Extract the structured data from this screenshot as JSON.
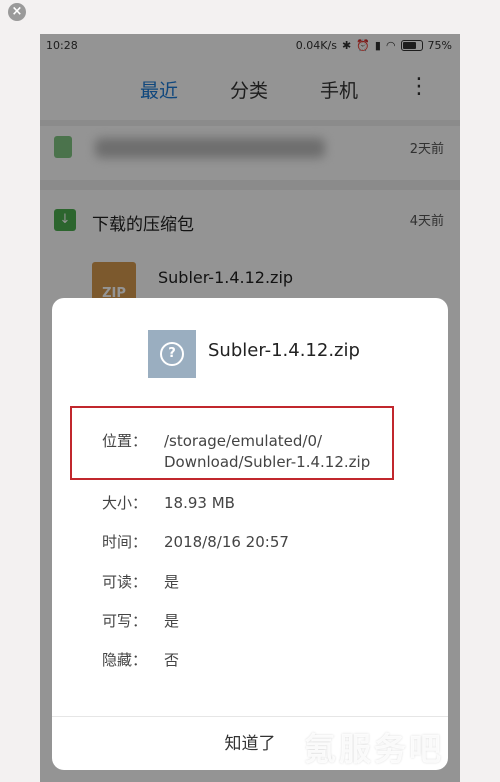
{
  "status_bar": {
    "time": "10:28",
    "network_speed": "0.04K/s",
    "battery": "75%"
  },
  "tabs": [
    {
      "label": "最近",
      "active": true
    },
    {
      "label": "分类",
      "active": false
    },
    {
      "label": "手机",
      "active": false
    }
  ],
  "list": {
    "blurred_item": {
      "date": "2天前"
    },
    "folder": {
      "label": "下载的压缩包",
      "date": "4天前"
    },
    "zip_item": {
      "icon_text": "ZIP",
      "name": "Subler-1.4.12.zip"
    }
  },
  "dialog": {
    "file_name": "Subler-1.4.12.zip",
    "location_key": "位置：",
    "location_value_line1": "/storage/emulated/0/",
    "location_value_line2": "Download/Subler-1.4.12.zip",
    "size_key": "大小：",
    "size_value": "18.93 MB",
    "time_key": "时间：",
    "time_value": "2018/8/16 20:57",
    "readable_key": "可读：",
    "readable_value": "是",
    "writable_key": "可写：",
    "writable_value": "是",
    "hidden_key": "隐藏：",
    "hidden_value": "否",
    "ok_label": "知道了"
  },
  "watermark": "氪服务吧",
  "colors": {
    "accent": "#1b7ad8",
    "link": "#2a8ed8",
    "highlight": "#c1272d"
  }
}
